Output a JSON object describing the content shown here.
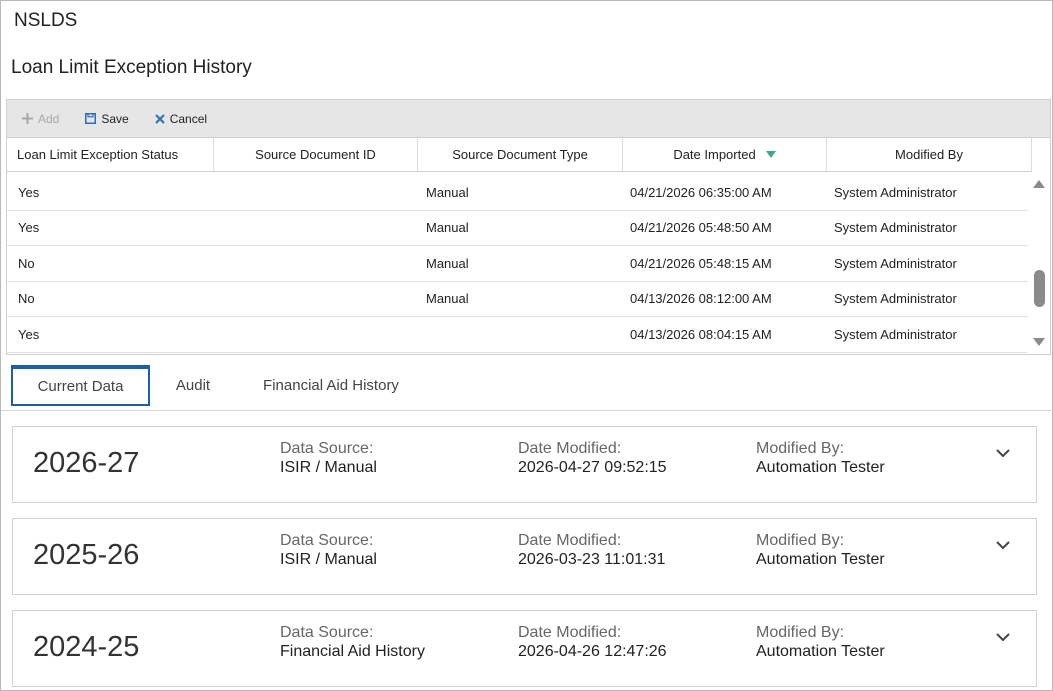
{
  "app": {
    "title": "NSLDS"
  },
  "section": {
    "title": "Loan Limit Exception History"
  },
  "toolbar": {
    "add_label": "Add",
    "save_label": "Save",
    "cancel_label": "Cancel"
  },
  "grid": {
    "columns": [
      "Loan Limit Exception Status",
      "Source Document ID",
      "Source Document Type",
      "Date Imported",
      "Modified By"
    ],
    "sorted_column": "Date Imported",
    "sort_direction": "descending",
    "rows": [
      [
        "Yes",
        "",
        "Manual",
        "04/21/2026 06:35:00 AM",
        "System Administrator"
      ],
      [
        "Yes",
        "",
        "Manual",
        "04/21/2026 05:48:50 AM",
        "System Administrator"
      ],
      [
        "No",
        "",
        "Manual",
        "04/21/2026 05:48:15 AM",
        "System Administrator"
      ],
      [
        "No",
        "",
        "Manual",
        "04/13/2026 08:12:00 AM",
        "System Administrator"
      ],
      [
        "Yes",
        "",
        "",
        "04/13/2026 08:04:15 AM",
        "System Administrator"
      ]
    ]
  },
  "tabs": [
    {
      "label": "Current Data",
      "active": true
    },
    {
      "label": "Audit",
      "active": false
    },
    {
      "label": "Financial Aid History",
      "active": false
    }
  ],
  "cards": [
    {
      "year": "2026-27",
      "data_source_label": "Data Source:",
      "data_source": "ISIR / Manual",
      "date_modified_label": "Date Modified:",
      "date_modified": "2026-04-27 09:52:15",
      "modified_by_label": "Modified By:",
      "modified_by": "Automation Tester"
    },
    {
      "year": "2025-26",
      "data_source_label": "Data Source:",
      "data_source": "ISIR / Manual",
      "date_modified_label": "Date Modified:",
      "date_modified": "2026-03-23 11:01:31",
      "modified_by_label": "Modified By:",
      "modified_by": "Automation Tester"
    },
    {
      "year": "2024-25",
      "data_source_label": "Data Source:",
      "data_source": "Financial Aid History",
      "date_modified_label": "Date Modified:",
      "date_modified": "2026-04-26 12:47:26",
      "modified_by_label": "Modified By:",
      "modified_by": "Automation Tester"
    }
  ],
  "colors": {
    "accent": "#1d5fa6",
    "sort_indicator": "#3aaa8c",
    "toolbar_bg": "#e6e6e6"
  }
}
